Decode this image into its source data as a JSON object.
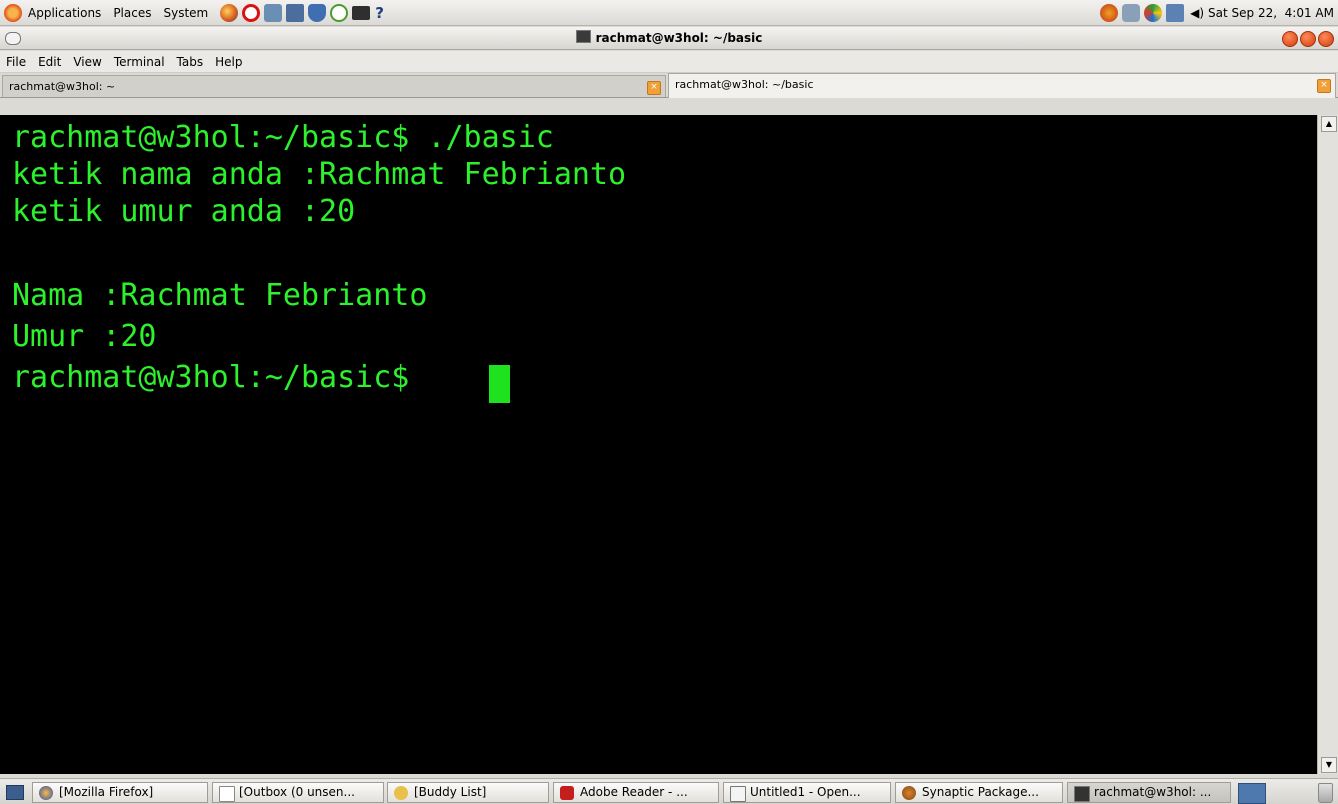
{
  "top_panel": {
    "menus": [
      "Applications",
      "Places",
      "System"
    ],
    "launcher_icons": [
      "firefox-icon",
      "opera-icon",
      "network-icon",
      "editor-icon",
      "shield-icon",
      "wireless-icon",
      "mail-icon",
      "help-icon"
    ],
    "help_glyph": "?",
    "clock": "Sat Sep 22,  4:01 AM",
    "tray_icons": [
      "update-icon",
      "network-monitor-icon",
      "messenger-icon",
      "display-icon",
      "volume-icon"
    ]
  },
  "window": {
    "title": "rachmat@w3hol: ~/basic"
  },
  "menubar": {
    "items": [
      "File",
      "Edit",
      "View",
      "Terminal",
      "Tabs",
      "Help"
    ]
  },
  "tabs": [
    {
      "label": "rachmat@w3hol: ~"
    },
    {
      "label": "rachmat@w3hol: ~/basic"
    }
  ],
  "terminal": {
    "lines": [
      "rachmat@w3hol:~/basic$ ./basic",
      "ketik nama anda :Rachmat Febrianto",
      "ketik umur anda :20",
      "",
      "Nama :Rachmat Febrianto",
      "Umur :20",
      "rachmat@w3hol:~/basic$ "
    ],
    "text_color": "#2cf12c",
    "background": "#000000"
  },
  "taskbar": {
    "items": [
      {
        "label": "[Mozilla Firefox]",
        "icon": "firefox-icon"
      },
      {
        "label": "[Outbox (0 unsen...",
        "icon": "envelope-icon"
      },
      {
        "label": "[Buddy List]",
        "icon": "pidgin-icon"
      },
      {
        "label": "Adobe Reader - ...",
        "icon": "adobe-reader-icon"
      },
      {
        "label": "Untitled1 - Open...",
        "icon": "document-icon"
      },
      {
        "label": "Synaptic Package...",
        "icon": "synaptic-icon"
      },
      {
        "label": "rachmat@w3hol: ...",
        "icon": "terminal-icon"
      }
    ]
  }
}
